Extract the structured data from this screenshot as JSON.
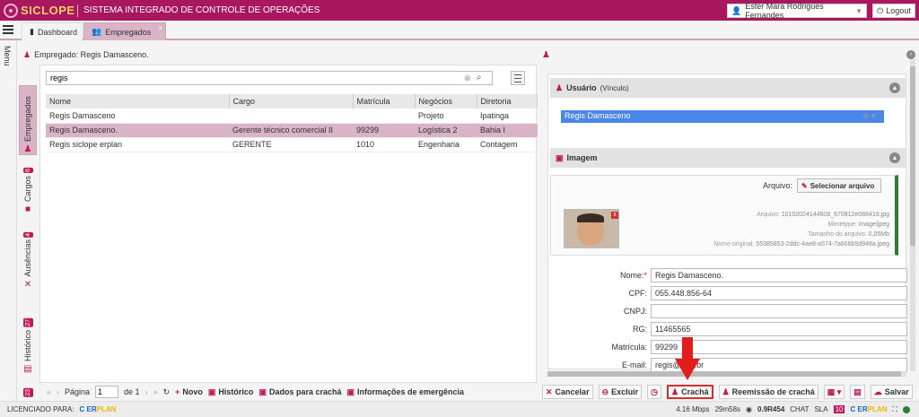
{
  "app": {
    "logo": "SICLOPE",
    "title": "SISTEMA INTEGRADO DE CONTROLE DE OPERAÇÕES",
    "user": "Ester Mara Rodrigues Fernandes",
    "logout": "Logout"
  },
  "tabs": [
    {
      "label": "Dashboard"
    },
    {
      "label": "Empregados"
    }
  ],
  "menu_label": "Menu",
  "vtabs": [
    {
      "label": "Empregados",
      "badge": ""
    },
    {
      "label": "Cargos",
      "badge": "6"
    },
    {
      "label": "Ausências",
      "badge": "4"
    },
    {
      "label": "Histórico",
      "badge": "27"
    },
    {
      "label": "",
      "badge": "23"
    }
  ],
  "header": {
    "title": "Empregado: Regis Damasceno."
  },
  "search": {
    "value": "regis"
  },
  "table": {
    "columns": [
      "Nome",
      "Cargo",
      "Matrícula",
      "Negócios",
      "Diretoria"
    ],
    "rows": [
      [
        "Regis Damasceno",
        "",
        "",
        "Projeto",
        "Ipatinga"
      ],
      [
        "Regis Damasceno.",
        "Gerente técnico comercial II",
        "99299",
        "Logística 2",
        "Bahia I"
      ],
      [
        "Regis siclope erplan",
        "GERENTE",
        "1010",
        "Engenharia",
        "Contagem"
      ]
    ]
  },
  "pager": {
    "page_label": "Página",
    "page": "1",
    "of_label": "de 1",
    "novo": "Novo",
    "historico": "Histórico",
    "dados": "Dados para crachá",
    "info": "Informações de emergência"
  },
  "usuario": {
    "title": "Usuário",
    "sub": "(Vínculo)",
    "value": "Regis Damasceno"
  },
  "imagem": {
    "title": "Imagem",
    "arquivo_label": "Arquivo:",
    "select_btn": "Selecionar arquivo",
    "meta": [
      {
        "k": "Arquivo:",
        "v": "10102024144608_670812e088418.jpg"
      },
      {
        "k": "Mimetype:",
        "v": "image/jpeg"
      },
      {
        "k": "Tamanho do arquivo:",
        "v": "0,05Mb"
      },
      {
        "k": "Nome original:",
        "v": "55385853-2ddc-4ae8-a574-7a666b5d948a.jpeg"
      }
    ]
  },
  "fields": [
    {
      "label": "Nome:",
      "req": "*",
      "value": "Regis Damasceno."
    },
    {
      "label": "CPF:",
      "req": "",
      "value": "055.448.856-64"
    },
    {
      "label": "CNPJ:",
      "req": "",
      "value": ""
    },
    {
      "label": "RG:",
      "req": "",
      "value": "11465565"
    },
    {
      "label": "Matrícula:",
      "req": "",
      "value": "99299"
    },
    {
      "label": "E-mail:",
      "req": "",
      "value": "regis@e...t.br"
    }
  ],
  "actions": {
    "cancelar": "Cancelar",
    "excluir": "Excluir",
    "cracha": "Crachá",
    "reemissao": "Reemissão de crachá",
    "salvar": "Salvar"
  },
  "status": {
    "lic": "LICENCIADO PARA:",
    "speed": "4.16 Mbps",
    "time": "29m58s",
    "version": "0.9R454",
    "chat": "CHAT",
    "sla": "SLA",
    "count": "10"
  },
  "colors": {
    "brand": "#a9175f",
    "accent": "#c0185a",
    "selected_row": "#d8b4c6"
  }
}
